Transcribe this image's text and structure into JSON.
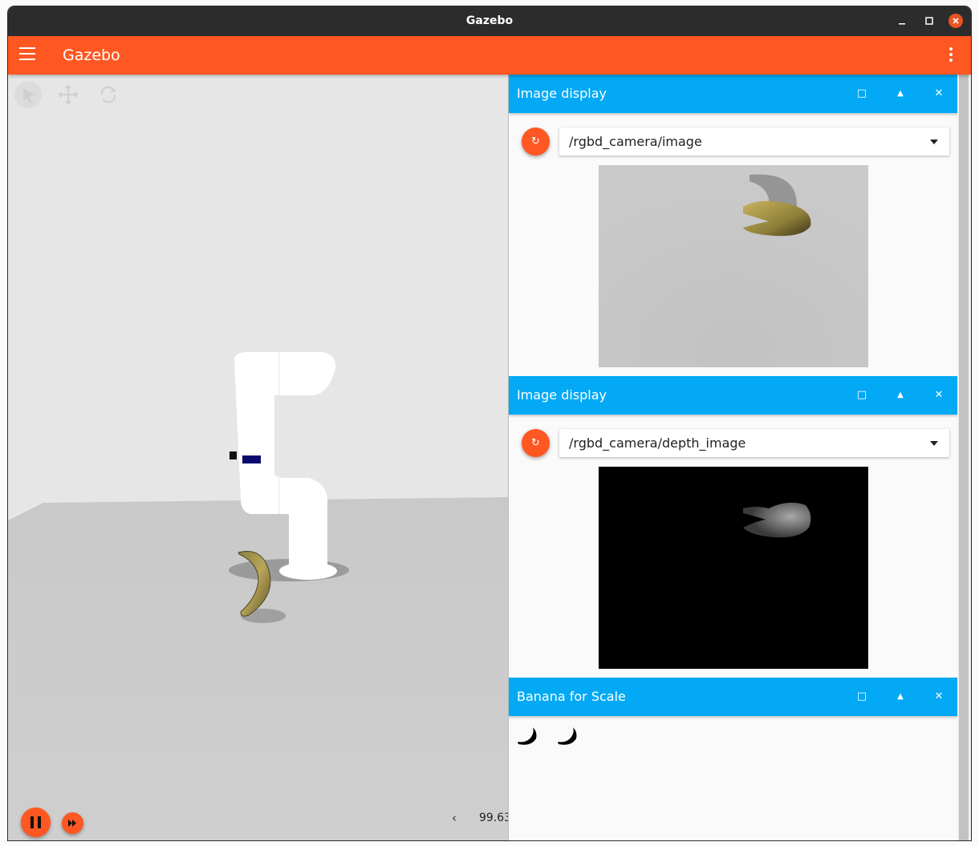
{
  "window": {
    "title": "Gazebo"
  },
  "appbar": {
    "title": "Gazebo"
  },
  "scene": {
    "tools": [
      "select-icon",
      "translate-icon",
      "rotate-icon"
    ],
    "rtf_arrow": "‹",
    "rtf_value": "99.63"
  },
  "panels": [
    {
      "title": "Image display",
      "topic": "/rgbd_camera/image",
      "refresh_glyph": "↻"
    },
    {
      "title": "Image display",
      "topic": "/rgbd_camera/depth_image",
      "refresh_glyph": "↻"
    },
    {
      "title": "Banana for Scale",
      "icons": [
        "banana-icon",
        "banana-icon"
      ]
    }
  ],
  "panel_buttons": {
    "maximize": "□",
    "collapse": "▲",
    "close": "✕"
  },
  "colors": {
    "accent_orange": "#ff5722",
    "panel_blue": "#03a9f4",
    "titlebar": "#2c2c2c",
    "close_orange": "#e95420"
  }
}
